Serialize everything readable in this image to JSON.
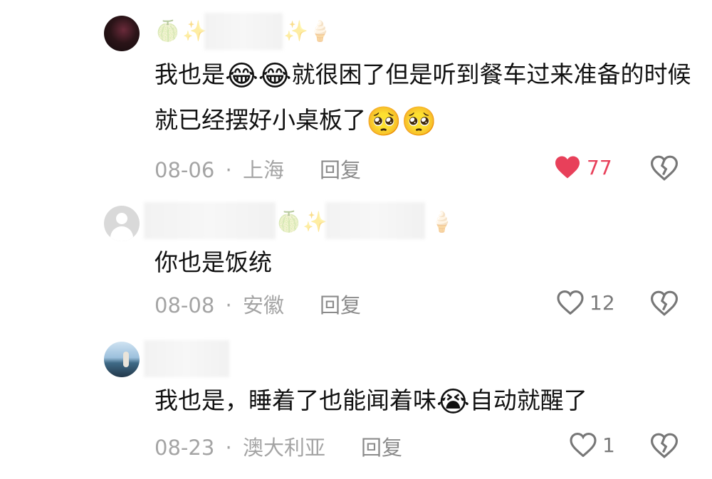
{
  "comments": [
    {
      "text_parts": [
        "我也是",
        "😂😂",
        "就很困了但是听到餐车过来准备的时候就已经摆好小桌板了",
        "🥺🥺"
      ],
      "date": "08-06",
      "location": "上海",
      "reply_label": "回复",
      "likes": "77",
      "liked": true,
      "decorations": [
        "🍈",
        "✨",
        "✨",
        "🍦"
      ]
    },
    {
      "text_parts": [
        "你也是饭统"
      ],
      "date": "08-08",
      "location": "安徽",
      "reply_label": "回复",
      "likes": "12",
      "liked": false,
      "decorations": [
        "🍈",
        "✨",
        "🍦"
      ]
    },
    {
      "text_parts": [
        "我也是，睡着了也能闻着味",
        "😭",
        "自动就醒了"
      ],
      "date": "08-23",
      "location": "澳大利亚",
      "reply_label": "回复",
      "likes": "1",
      "liked": false,
      "decorations": []
    }
  ],
  "separator": "·",
  "colors": {
    "like_active": "#e8405a",
    "meta": "#a4a4a4",
    "text": "#111111"
  },
  "icons": [
    "heart-icon",
    "broken-heart-icon"
  ]
}
